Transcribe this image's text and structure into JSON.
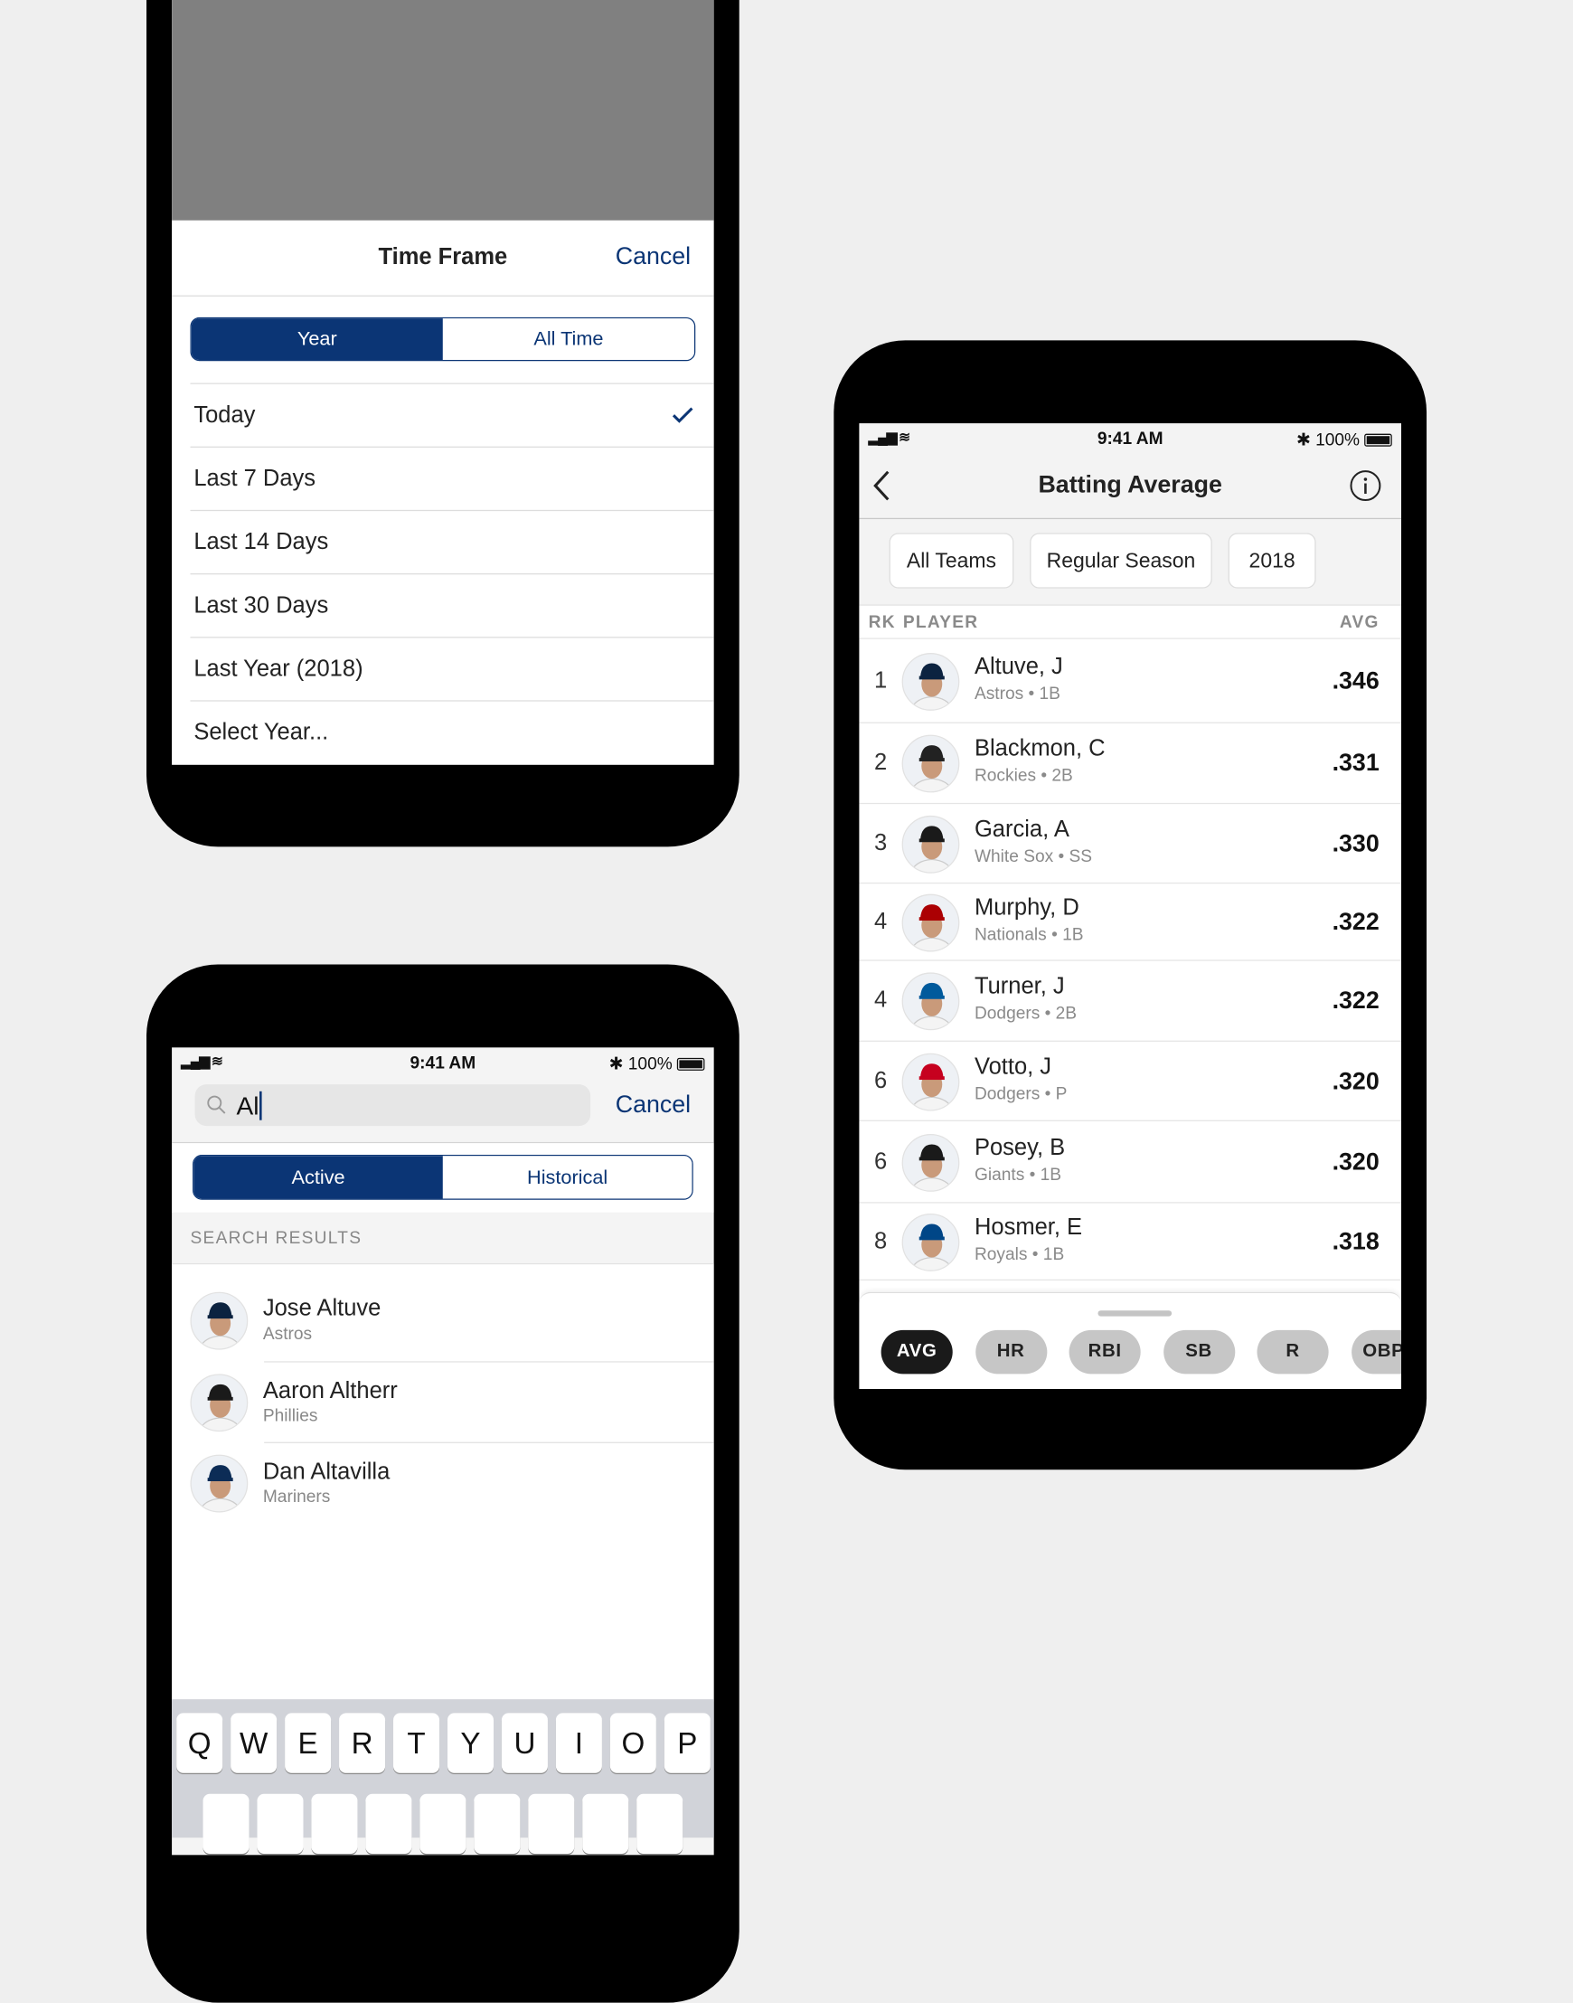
{
  "colors": {
    "accent": "#0b3575",
    "overlay": "#808080",
    "keyboard": "#d1d3d9"
  },
  "timeframe": {
    "title": "Time Frame",
    "cancel": "Cancel",
    "segments": [
      "Year",
      "All Time"
    ],
    "selected_segment": "Year",
    "options": [
      "Today",
      "Last 7 Days",
      "Last 14 Days",
      "Last 30 Days",
      "Last Year (2018)",
      "Select Year..."
    ],
    "checked": "Today"
  },
  "status": {
    "time": "9:41 AM",
    "battery": "100%"
  },
  "search": {
    "value": "Al",
    "cancel": "Cancel",
    "segments": [
      "Active",
      "Historical"
    ],
    "selected_segment": "Active",
    "section": "SEARCH RESULTS",
    "results": [
      {
        "name": "Jose Altuve",
        "team": "Astros",
        "cap": "#0c2340"
      },
      {
        "name": "Aaron Altherr",
        "team": "Phillies",
        "cap": "#1a1a1a"
      },
      {
        "name": "Dan Altavilla",
        "team": "Mariners",
        "cap": "#0c2c56"
      }
    ],
    "keys": [
      "Q",
      "W",
      "E",
      "R",
      "T",
      "Y",
      "U",
      "I",
      "O",
      "P"
    ]
  },
  "leaders": {
    "title": "Batting Average",
    "filters": [
      "All Teams",
      "Regular Season",
      "2018"
    ],
    "col_rk": "RK",
    "col_player": "PLAYER",
    "col_avg": "AVG",
    "rows": [
      {
        "rk": "1",
        "name": "Altuve, J",
        "team": "Astros",
        "pos": "1B",
        "avg": ".346",
        "cap": "#0c2340"
      },
      {
        "rk": "2",
        "name": "Blackmon, C",
        "team": "Rockies",
        "pos": "2B",
        "avg": ".331",
        "cap": "#222"
      },
      {
        "rk": "3",
        "name": "Garcia, A",
        "team": "White Sox",
        "pos": "SS",
        "avg": ".330",
        "cap": "#1a1a1a"
      },
      {
        "rk": "4",
        "name": "Murphy, D",
        "team": "Nationals",
        "pos": "1B",
        "avg": ".322",
        "cap": "#ab0003"
      },
      {
        "rk": "4",
        "name": "Turner, J",
        "team": "Dodgers",
        "pos": "2B",
        "avg": ".322",
        "cap": "#005a9c"
      },
      {
        "rk": "6",
        "name": "Votto, J",
        "team": "Dodgers",
        "pos": "P",
        "avg": ".320",
        "cap": "#c6011f"
      },
      {
        "rk": "6",
        "name": "Posey, B",
        "team": "Giants",
        "pos": "1B",
        "avg": ".320",
        "cap": "#1a1a1a"
      },
      {
        "rk": "8",
        "name": "Hosmer, E",
        "team": "Royals",
        "pos": "1B",
        "avg": ".318",
        "cap": "#004687"
      }
    ],
    "stats": [
      "AVG",
      "HR",
      "RBI",
      "SB",
      "R",
      "OBP"
    ],
    "selected_stat": "AVG"
  }
}
